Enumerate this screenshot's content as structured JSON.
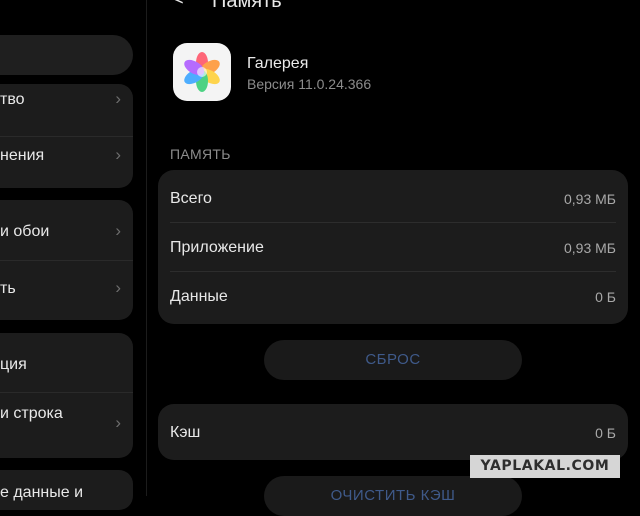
{
  "header": {
    "back_glyph": "<",
    "title": "Память"
  },
  "sidebar": {
    "items": [
      {
        "label": "тво"
      },
      {
        "label": "нения"
      },
      {
        "label": "и обои"
      },
      {
        "label": "ть"
      },
      {
        "label": "ция"
      },
      {
        "label": "и строка"
      },
      {
        "label": "е данные и"
      }
    ],
    "chevron": "›"
  },
  "app": {
    "name": "Галерея",
    "version": "Версия 11.0.24.366",
    "icon": "gallery-pinwheel-icon"
  },
  "storage": {
    "section_title": "ПАМЯТЬ",
    "rows": [
      {
        "label": "Всего",
        "value": "0,93 МБ"
      },
      {
        "label": "Приложение",
        "value": "0,93 МБ"
      },
      {
        "label": "Данные",
        "value": "0 Б"
      }
    ],
    "reset_label": "СБРОС"
  },
  "cache": {
    "label": "Кэш",
    "value": "0 Б",
    "clear_label": "ОЧИСТИТЬ КЭШ"
  },
  "watermark": "YAPLAKAL.COM",
  "colors": {
    "background": "#000000",
    "card": "#1c1c1c",
    "button_text": "#3f5a8a"
  }
}
